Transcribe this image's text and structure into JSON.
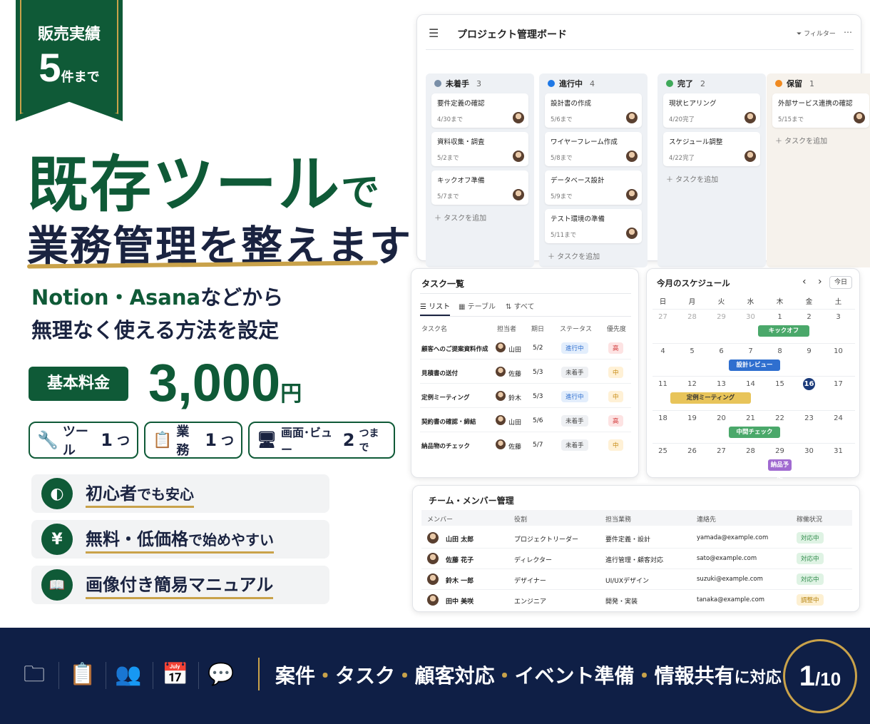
{
  "ribbon": {
    "line1": "販売実績",
    "num": "5",
    "line2": "件まで"
  },
  "headline": {
    "line1": "既存ツール",
    "line1_suffix": "で",
    "line2": "業務管理を整えます"
  },
  "subtitle": {
    "brands": "Notion・Asana",
    "line1_rest": "などから",
    "line2": "無理なく使える方法を設定"
  },
  "price": {
    "badge": "基本料金",
    "value": "3,000",
    "unit": "円"
  },
  "pills": [
    {
      "icon": "wrench-icon",
      "label": "ツール",
      "num": "1",
      "suffix": "つ"
    },
    {
      "icon": "clipboard-icon",
      "label": "業務",
      "num": "1",
      "suffix": "つ"
    },
    {
      "icon": "monitor-icon",
      "label": "画面･ビュー",
      "num": "2",
      "suffix": "つまで"
    }
  ],
  "features": [
    {
      "icon": "beginner-leaf-icon",
      "glyph": "◐",
      "strong": "初心者",
      "rest": "でも安心"
    },
    {
      "icon": "yen-icon",
      "glyph": "¥",
      "strong": "無料・低価格",
      "rest": "で始めやすい"
    },
    {
      "icon": "book-icon",
      "glyph": "📖",
      "strong": "画像付き簡易マニュアル",
      "rest": ""
    }
  ],
  "board": {
    "title": "プロジェクト管理ボード",
    "filter": "フィルター",
    "more": "…",
    "add": "＋ タスクを追加",
    "columns": [
      {
        "name": "未着手",
        "count": "3",
        "color": "#7a8fa8",
        "bg": "#eef1f5",
        "cards": [
          {
            "title": "要件定義の確認",
            "date": "4/30まで"
          },
          {
            "title": "資料収集・調査",
            "date": "5/2まで"
          },
          {
            "title": "キックオフ準備",
            "date": "5/7まで"
          }
        ]
      },
      {
        "name": "進行中",
        "count": "4",
        "color": "#1e78e6",
        "bg": "#eef1f5",
        "cards": [
          {
            "title": "設計書の作成",
            "date": "5/6まで"
          },
          {
            "title": "ワイヤーフレーム作成",
            "date": "5/8まで"
          },
          {
            "title": "データベース設計",
            "date": "5/9まで"
          },
          {
            "title": "テスト環境の準備",
            "date": "5/11まで"
          }
        ]
      },
      {
        "name": "完了",
        "count": "2",
        "color": "#3fa95a",
        "bg": "#eef1f5",
        "cards": [
          {
            "title": "現状ヒアリング",
            "date": "4/20完了"
          },
          {
            "title": "スケジュール調整",
            "date": "4/22完了"
          }
        ]
      },
      {
        "name": "保留",
        "count": "1",
        "color": "#f08a20",
        "bg": "#f6f2ec",
        "cards": [
          {
            "title": "外部サービス連携の確認",
            "date": "5/15まで"
          }
        ]
      }
    ]
  },
  "tasks": {
    "title": "タスク一覧",
    "tabs": [
      "リスト",
      "テーブル",
      "すべて"
    ],
    "headers": [
      "タスク名",
      "担当者",
      "期日",
      "ステータス",
      "優先度"
    ],
    "rows": [
      {
        "name": "顧客へのご提案資料作成",
        "person": "山田",
        "due": "5/2",
        "status": "進行中",
        "prio": "高"
      },
      {
        "name": "見積書の送付",
        "person": "佐藤",
        "due": "5/3",
        "status": "未着手",
        "prio": "中"
      },
      {
        "name": "定例ミーティング",
        "person": "鈴木",
        "due": "5/3",
        "status": "進行中",
        "prio": "中"
      },
      {
        "name": "契約書の確認・締結",
        "person": "山田",
        "due": "5/6",
        "status": "未着手",
        "prio": "高"
      },
      {
        "name": "納品物のチェック",
        "person": "佐藤",
        "due": "5/7",
        "status": "未着手",
        "prio": "中"
      }
    ]
  },
  "calendar": {
    "title": "今月のスケジュール",
    "today": "今日",
    "prev": "‹",
    "next": "›",
    "weekdays": [
      "日",
      "月",
      "火",
      "水",
      "木",
      "金",
      "土"
    ],
    "weeks": [
      [
        "27",
        "28",
        "29",
        "30",
        "1",
        "2",
        "3"
      ],
      [
        "4",
        "5",
        "6",
        "7",
        "8",
        "9",
        "10"
      ],
      [
        "11",
        "12",
        "13",
        "14",
        "15",
        "16",
        "17"
      ],
      [
        "18",
        "19",
        "20",
        "21",
        "22",
        "23",
        "24"
      ],
      [
        "25",
        "26",
        "27",
        "28",
        "29",
        "30",
        "31"
      ]
    ],
    "events": [
      {
        "label": "キックオフ",
        "week": 0,
        "col": 4,
        "span": 2,
        "color": "#4aa86a"
      },
      {
        "label": "設計レビュー",
        "week": 1,
        "col": 3,
        "span": 2,
        "color": "#2f6fcf"
      },
      {
        "label": "定例ミーティング",
        "week": 2,
        "col": 1,
        "span": 3,
        "color": "#e8c45a"
      },
      {
        "label": "中間チェック",
        "week": 3,
        "col": 3,
        "span": 2,
        "color": "#4aa86a"
      },
      {
        "label": "納品予定",
        "week": 4,
        "col": 4,
        "span": 1,
        "color": "#a06ad0"
      }
    ],
    "highlight": "16"
  },
  "team": {
    "title": "チーム・メンバー管理",
    "headers": [
      "メンバー",
      "役割",
      "担当業務",
      "連絡先",
      "稼働状況"
    ],
    "rows": [
      {
        "name": "山田 太郎",
        "role": "プロジェクトリーダー",
        "work": "要件定義・設計",
        "mail": "yamada@example.com",
        "status": "対応中"
      },
      {
        "name": "佐藤 花子",
        "role": "ディレクター",
        "work": "進行管理・顧客対応",
        "mail": "sato@example.com",
        "status": "対応中"
      },
      {
        "name": "鈴木 一郎",
        "role": "デザイナー",
        "work": "UI/UXデザイン",
        "mail": "suzuki@example.com",
        "status": "対応中"
      },
      {
        "name": "田中 美咲",
        "role": "エンジニア",
        "work": "開発・実装",
        "mail": "tanaka@example.com",
        "status": "調整中"
      }
    ]
  },
  "bottom": {
    "icons": [
      "folder-icon",
      "checklist-icon",
      "team-icon",
      "calendar-icon",
      "chat-icon"
    ],
    "items": [
      "案件",
      "タスク",
      "顧客対応",
      "イベント準備",
      "情報共有"
    ],
    "dot": "・",
    "suffix": "に対応",
    "page": "1",
    "total": "/10"
  },
  "colors": {
    "brand_green": "#0f5a37",
    "gold": "#c9a24a",
    "navy": "#0f1f46"
  }
}
